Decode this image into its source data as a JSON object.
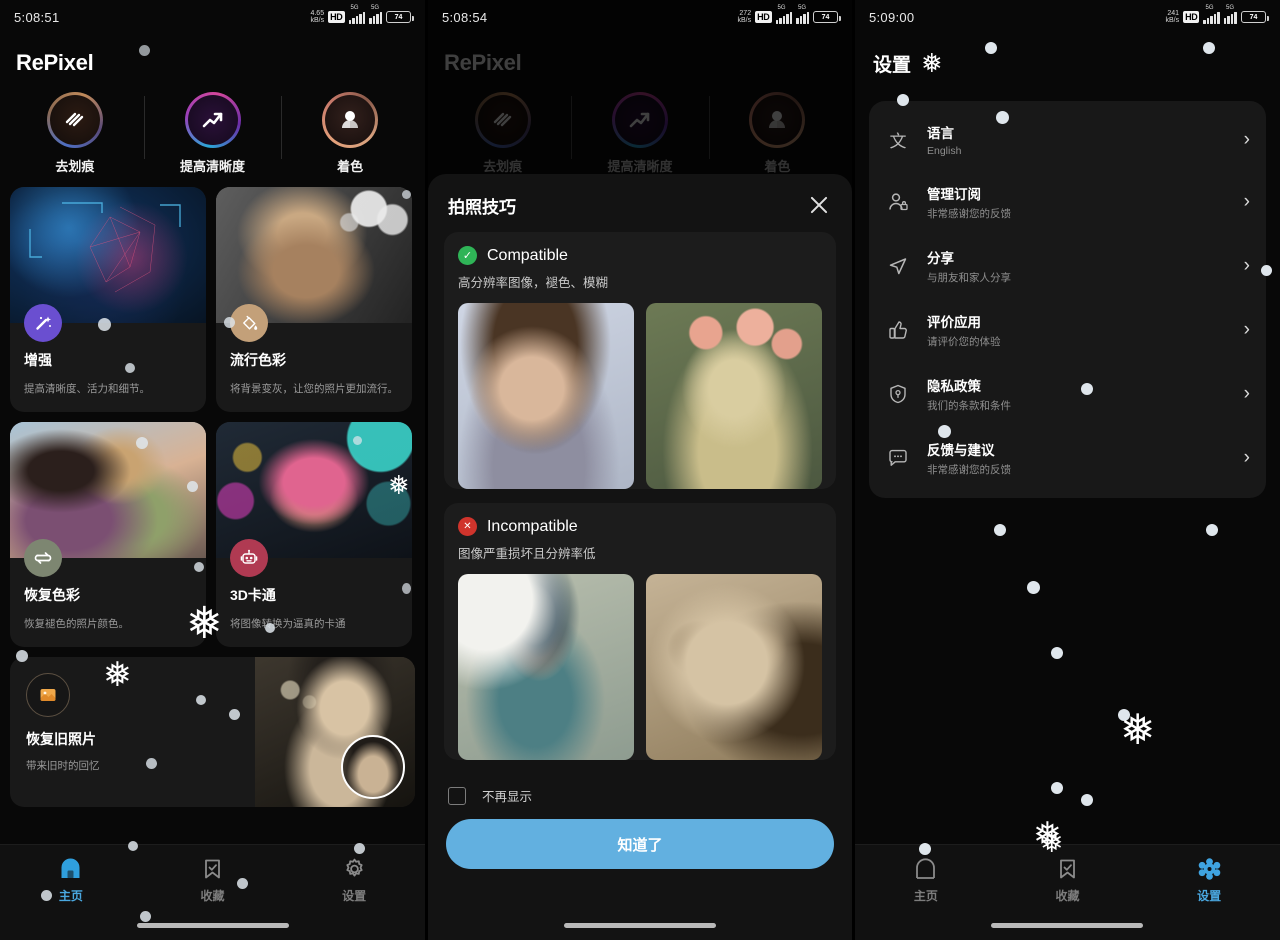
{
  "app": {
    "name": "RePixel"
  },
  "panel1": {
    "status": {
      "time": "5:08:51",
      "net_speed": "4.65",
      "net_unit": "kB/s",
      "hd": "HD",
      "net_type_1": "5G",
      "net_type_2": "5G",
      "battery": "74"
    },
    "top_actions": [
      {
        "label": "去划痕",
        "icon": "scratch-lines-icon"
      },
      {
        "label": "提高清晰度",
        "icon": "trend-up-icon"
      },
      {
        "label": "着色",
        "icon": "colorize-person-icon"
      }
    ],
    "cards": [
      {
        "title": "增强",
        "desc": "提高清晰度、活力和细节。",
        "icon": "magic-wand-icon",
        "badge_color": "#6a4fd0"
      },
      {
        "title": "流行色彩",
        "desc": "将背景变灰，让您的照片更加流行。",
        "icon": "paint-bucket-icon",
        "badge_color": "#c3a079"
      },
      {
        "title": "恢复色彩",
        "desc": "恢复褪色的照片颜色。",
        "icon": "swap-arrows-icon",
        "badge_color": "#7d8671"
      },
      {
        "title": "3D卡通",
        "desc": "将图像转换为逼真的卡通",
        "icon": "robot-icon",
        "badge_color": "#b03a52"
      }
    ],
    "wide_card": {
      "title": "恢复旧照片",
      "desc": "带来旧时的回忆",
      "icon": "photo-restore-icon"
    },
    "nav": [
      {
        "label": "主页",
        "icon": "home-icon",
        "active": true
      },
      {
        "label": "收藏",
        "icon": "bookmark-check-icon",
        "active": false
      },
      {
        "label": "设置",
        "icon": "gear-icon",
        "active": false
      }
    ]
  },
  "panel2": {
    "status": {
      "time": "5:08:54",
      "net_speed": "272",
      "net_unit": "kB/s",
      "hd": "HD",
      "net_type_1": "5G",
      "net_type_2": "5G",
      "battery": "74"
    },
    "top_actions": [
      {
        "label": "去划痕",
        "icon": "scratch-lines-icon"
      },
      {
        "label": "提高清晰度",
        "icon": "trend-up-icon"
      },
      {
        "label": "着色",
        "icon": "colorize-person-icon"
      }
    ],
    "dialog": {
      "title": "拍照技巧",
      "close_icon": "close-icon",
      "compatible": {
        "status_icon": "check-circle-icon",
        "status_color": "#2fb457",
        "label": "Compatible",
        "desc": "高分辨率图像，褪色、模糊"
      },
      "incompatible": {
        "status_icon": "x-circle-icon",
        "status_color": "#d0342c",
        "label": "Incompatible",
        "desc": "图像严重损坏且分辨率低"
      },
      "checkbox_label": "不再显示",
      "confirm_label": "知道了",
      "confirm_color": "#62b0e0"
    }
  },
  "panel3": {
    "status": {
      "time": "5:09:00",
      "net_speed": "241",
      "net_unit": "kB/s",
      "hd": "HD",
      "net_type_1": "5G",
      "net_type_2": "5G",
      "battery": "74"
    },
    "title": "设置",
    "settings": [
      {
        "title": "语言",
        "sub": "English",
        "icon": "language-icon",
        "chevron": "›"
      },
      {
        "title": "管理订阅",
        "sub": "非常感谢您的反馈",
        "icon": "user-lock-icon",
        "chevron": "›"
      },
      {
        "title": "分享",
        "sub": "与朋友和家人分享",
        "icon": "send-icon",
        "chevron": "›"
      },
      {
        "title": "评价应用",
        "sub": "请评价您的体验",
        "icon": "thumbs-up-icon",
        "chevron": "›"
      },
      {
        "title": "隐私政策",
        "sub": "我们的条款和条件",
        "icon": "shield-key-icon",
        "chevron": "›"
      },
      {
        "title": "反馈与建议",
        "sub": "非常感谢您的反馈",
        "icon": "chat-bubble-icon",
        "chevron": "›"
      }
    ],
    "nav": [
      {
        "label": "主页",
        "icon": "home-icon",
        "active": false
      },
      {
        "label": "收藏",
        "icon": "bookmark-check-icon",
        "active": false
      },
      {
        "label": "设置",
        "icon": "flower-gear-icon",
        "active": true
      }
    ]
  }
}
